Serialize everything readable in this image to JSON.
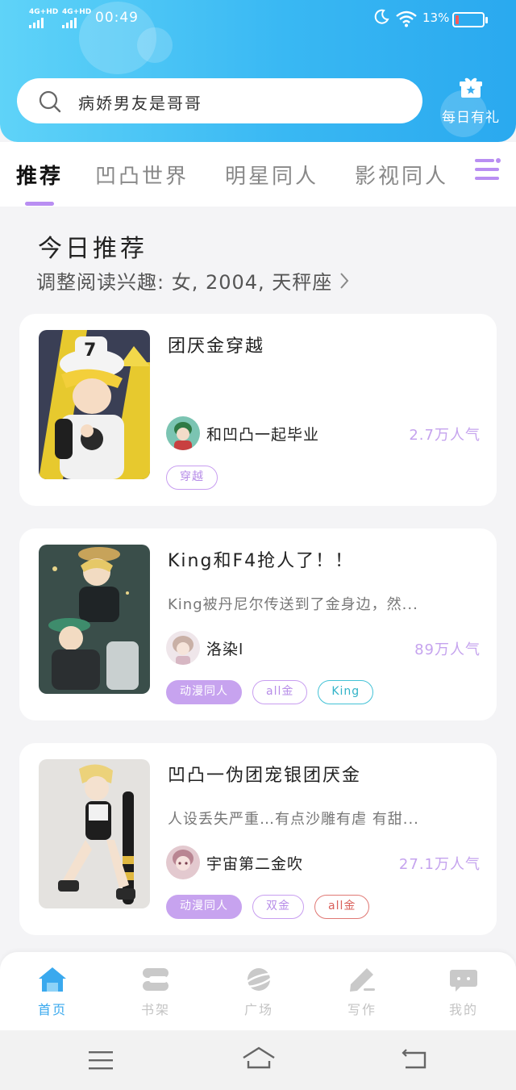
{
  "status_bar": {
    "signal1": "4G+HD",
    "signal2": "4G+HD",
    "time": "00:49",
    "battery": "13%",
    "battery_level": 0.13
  },
  "search": {
    "query": "病娇男友是哥哥",
    "icon": "search-icon"
  },
  "daily_gift": {
    "label": "每日有礼",
    "icon": "gift-icon"
  },
  "tabs": [
    {
      "label": "推荐",
      "active": true
    },
    {
      "label": "凹凸世界",
      "active": false
    },
    {
      "label": "明星同人",
      "active": false
    },
    {
      "label": "影视同人",
      "active": false
    }
  ],
  "section": {
    "title": "今日推荐",
    "subtitle": "调整阅读兴趣: 女, 2004, 天秤座"
  },
  "books": [
    {
      "title": "团厌金穿越",
      "description": "",
      "author": "和凹凸一起毕业",
      "popularity": "2.7万人气",
      "tags": [
        {
          "label": "穿越",
          "style": "outline-purple"
        }
      ]
    },
    {
      "title": "King和F4抢人了！！",
      "description": "King被丹尼尔传送到了金身边，然...",
      "author": "洛染l",
      "popularity": "89万人气",
      "tags": [
        {
          "label": "动漫同人",
          "style": "solid-purple"
        },
        {
          "label": "all金",
          "style": "outline-purple"
        },
        {
          "label": "King",
          "style": "outline-teal"
        }
      ]
    },
    {
      "title": "凹凸一伪团宠银团厌金",
      "description": "人设丢失严重…有点沙雕有虐 有甜...",
      "author": "宇宙第二金吹",
      "popularity": "27.1万人气",
      "tags": [
        {
          "label": "动漫同人",
          "style": "solid-purple"
        },
        {
          "label": "双金",
          "style": "outline-purple"
        },
        {
          "label": "all金",
          "style": "outline-red"
        }
      ]
    }
  ],
  "bottom_nav": [
    {
      "label": "首页",
      "icon": "home-icon",
      "active": true
    },
    {
      "label": "书架",
      "icon": "bookshelf-icon",
      "active": false
    },
    {
      "label": "广场",
      "icon": "planet-icon",
      "active": false
    },
    {
      "label": "写作",
      "icon": "pen-icon",
      "active": false
    },
    {
      "label": "我的",
      "icon": "chat-bubble-icon",
      "active": false
    }
  ],
  "colors": {
    "header_gradient_start": "#5fd3f8",
    "header_gradient_end": "#2aa9ef",
    "accent_purple": "#c7a3ef",
    "popularity_purple": "#c5a3ee",
    "nav_active": "#3aa9ee"
  }
}
